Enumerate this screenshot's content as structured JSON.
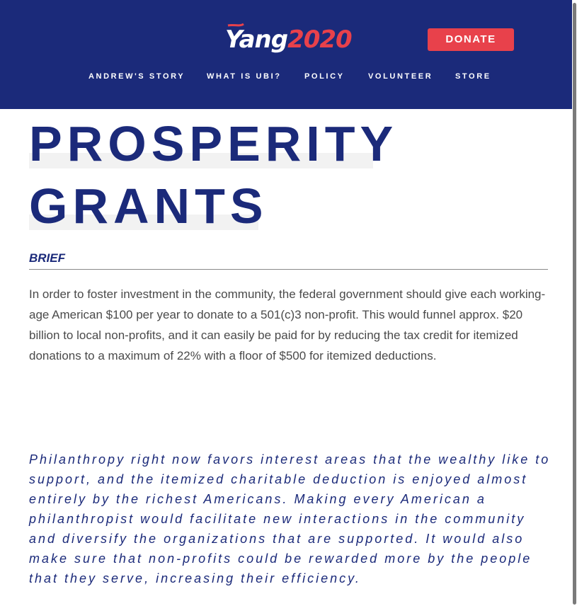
{
  "header": {
    "logo": {
      "name_text": "Yang",
      "year_text": "2020"
    },
    "donate_label": "DONATE",
    "nav": [
      {
        "label": "ANDREW'S STORY"
      },
      {
        "label": "WHAT IS UBI?"
      },
      {
        "label": "POLICY"
      },
      {
        "label": "VOLUNTEER"
      },
      {
        "label": "STORE"
      }
    ]
  },
  "main": {
    "title_line_1": "PROSPERITY",
    "title_line_2": "GRANTS",
    "brief_label": "BRIEF",
    "brief_text": "In order to foster investment in the community, the federal government should give each working-age American $100 per year to donate to a 501(c)3 non-profit. This would funnel approx. $20 billion to local non-profits, and it can easily be paid for by reducing the tax credit for itemized donations to a maximum of 22% with a floor of $500 for itemized deductions.",
    "quote_text": "Philanthropy right now favors interest areas that the wealthy like to support, and the itemized charitable deduction is enjoyed almost entirely by the richest Americans. Making every American a philanthropist would facilitate new interactions in the community and diversify the organizations that are supported. It would also make sure that non-profits could be rewarded more by the people that they serve, increasing their efficiency."
  },
  "colors": {
    "brand_navy": "#1b2a7a",
    "accent_red": "#e8414b",
    "body_text": "#4a4a4a"
  }
}
